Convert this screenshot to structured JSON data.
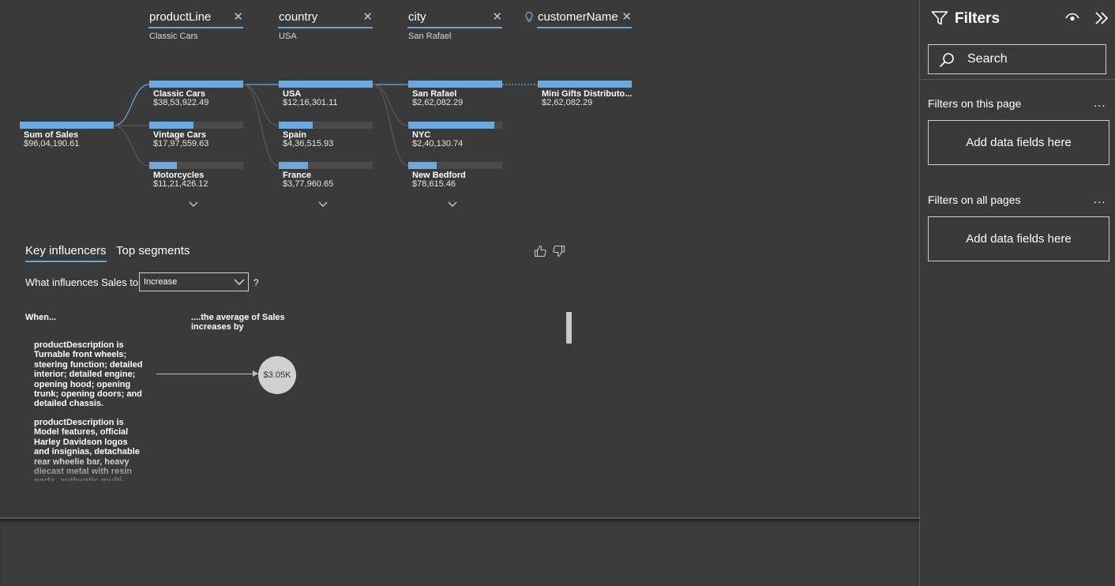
{
  "tree": {
    "levels": [
      {
        "field": "productLine",
        "selected": "Classic Cars"
      },
      {
        "field": "country",
        "selected": "USA"
      },
      {
        "field": "city",
        "selected": "San Rafael"
      },
      {
        "field": "customerName",
        "selected": ""
      }
    ],
    "root": {
      "name": "Sum of Sales",
      "value": "$96,04,190.61",
      "share": 1.0
    },
    "productLine": [
      {
        "name": "Classic Cars",
        "value": "$38,53,922.49",
        "share": 1.0
      },
      {
        "name": "Vintage Cars",
        "value": "$17,97,559.63",
        "share": 0.47
      },
      {
        "name": "Motorcycles",
        "value": "$11,21,426.12",
        "share": 0.29
      }
    ],
    "country": [
      {
        "name": "USA",
        "value": "$12,16,301.11",
        "share": 1.0
      },
      {
        "name": "Spain",
        "value": "$4,36,515.93",
        "share": 0.36
      },
      {
        "name": "France",
        "value": "$3,77,960.65",
        "share": 0.31
      }
    ],
    "city": [
      {
        "name": "San Rafael",
        "value": "$2,62,082.29",
        "share": 1.0
      },
      {
        "name": "NYC",
        "value": "$2,40,130.74",
        "share": 0.92
      },
      {
        "name": "New Bedford",
        "value": "$78,615.46",
        "share": 0.3
      }
    ],
    "customerName": [
      {
        "name": "Mini Gifts Distributo...",
        "value": "$2,62,082.29",
        "share": 1.0
      }
    ]
  },
  "influencers": {
    "tabs": [
      "Key influencers",
      "Top segments"
    ],
    "question": "What influences Sales to",
    "dropdown_value": "Increase",
    "question_suffix": "?",
    "col_when": "When...",
    "col_avg": "....the average of Sales increases by",
    "items": [
      {
        "text": "productDescription is Turnable front wheels; steering function; detailed interior; detailed engine; opening hood; opening trunk; opening doors; and detailed chassis.",
        "impact": "$3.05K"
      },
      {
        "text": "productDescription is Model features, official Harley Davidson logos and insignias, detachable rear wheelie bar, heavy diecast metal with resin parts, authentic multi-color tampo-"
      }
    ]
  },
  "filters": {
    "title": "Filters",
    "search_label": "Search",
    "section_page": "Filters on this page",
    "section_all": "Filters on all pages",
    "dots": "...",
    "add_fields": "Add data fields here"
  },
  "colors": {
    "accent": "#6ca9dc",
    "background": "#3a3a3a",
    "bar_track": "#4a4a4a"
  }
}
